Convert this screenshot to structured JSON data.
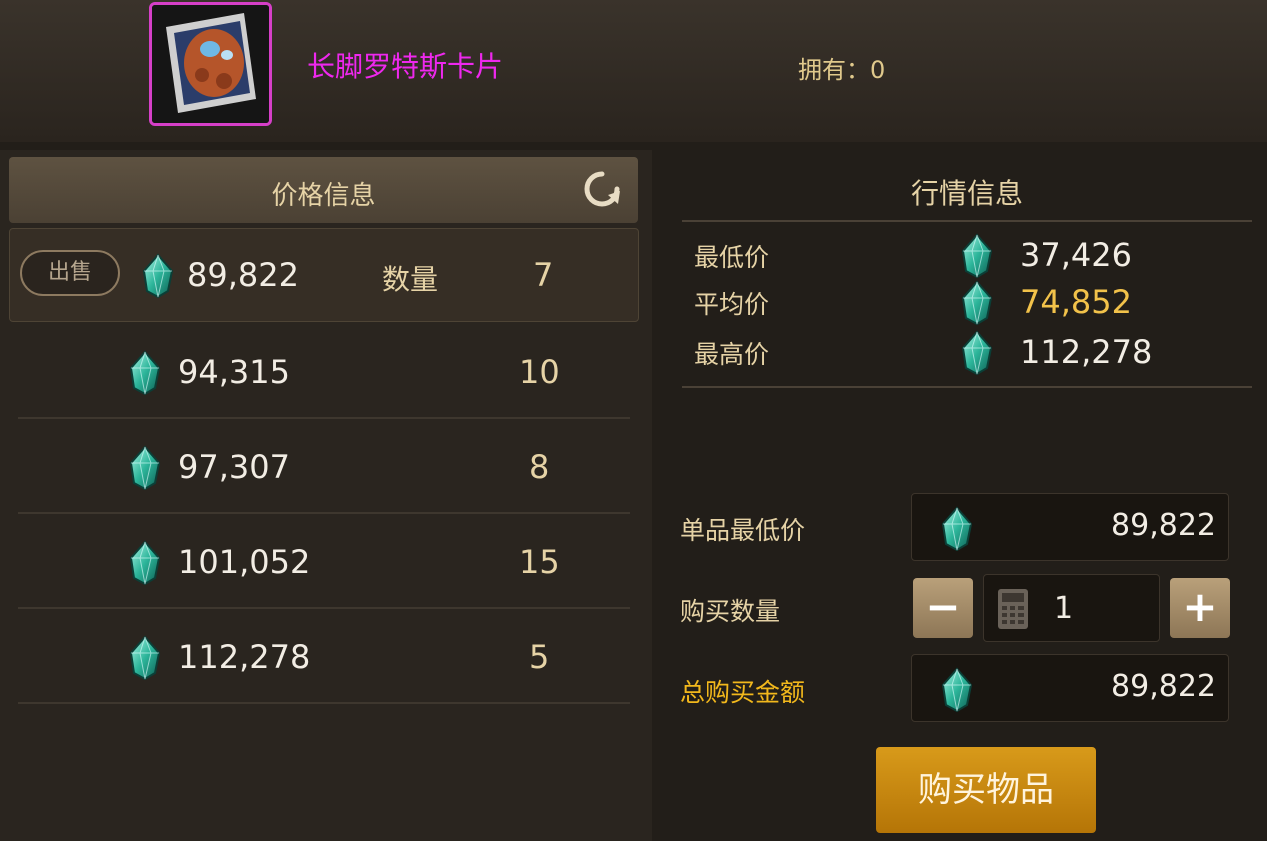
{
  "item": {
    "name": "长脚罗特斯卡片",
    "owned_text": "拥有：0"
  },
  "price_panel": {
    "title": "价格信息",
    "sell_label": "出售",
    "quantity_label": "数量",
    "rows": [
      {
        "price": "89,822",
        "qty": "7"
      },
      {
        "price": "94,315",
        "qty": "10"
      },
      {
        "price": "97,307",
        "qty": "8"
      },
      {
        "price": "101,052",
        "qty": "15"
      },
      {
        "price": "112,278",
        "qty": "5"
      }
    ]
  },
  "market_panel": {
    "title": "行情信息",
    "stats": [
      {
        "label": "最低价",
        "value": "37,426",
        "color": "#f2ede4"
      },
      {
        "label": "平均价",
        "value": "74,852",
        "color": "#f2c24a"
      },
      {
        "label": "最高价",
        "value": "112,278",
        "color": "#f2ede4"
      }
    ]
  },
  "purchase": {
    "unit_min_label": "单品最低价",
    "unit_min_value": "89,822",
    "qty_label": "购买数量",
    "qty_value": "1",
    "total_label": "总购买金额",
    "total_value": "89,822",
    "buy_button": "购买物品"
  }
}
